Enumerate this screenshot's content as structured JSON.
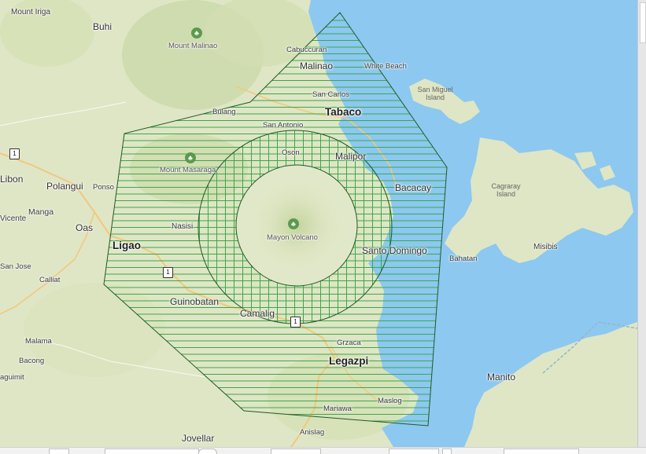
{
  "map": {
    "labels": {
      "mount_iriga": "Mount Iriga",
      "buhi": "Buhi",
      "mount_malinao": "Mount Malinao",
      "cabuccuran": "Cabuccuran",
      "malinao": "Malinao",
      "white_beach": "White Beach",
      "san_carlos": "San Carlos",
      "san_miguel_island": "San Miguel Island",
      "bulang": "Bulang",
      "tabaco": "Tabaco",
      "san_antonio": "San Antonio",
      "oson": "Oson",
      "malipor": "Malipor",
      "mount_masaraga": "Mount Masaraga",
      "libon": "Libon",
      "polangui": "Polangui",
      "ponso": "Ponso",
      "bacacay": "Bacacay",
      "cagraray_island": "Cagraray Island",
      "manga": "Manga",
      "vicente": "Vicente",
      "oas": "Oas",
      "nasisi": "Nasisi",
      "mayon_volcano": "Mayon Volcano",
      "ligao": "Ligao",
      "santo_domingo": "Santo Domingo",
      "bahatan": "Bahatan",
      "misibis": "Misibis",
      "san_jose": "San Jose",
      "calliat": "Calliat",
      "guinobatan": "Guinobatan",
      "camalig": "Camalig",
      "malama": "Malama",
      "grzaca": "Grzaca",
      "bacong": "Bacong",
      "legazpi": "Legazpi",
      "manito": "Manito",
      "aguimit": "aguimit",
      "maslog": "Maslog",
      "mariawa": "Mariawa",
      "jovellar": "Jovellar",
      "anislag": "Anislag"
    },
    "highway_shield": "1",
    "colors": {
      "land": "#dfe6c5",
      "land_hill": "#cfdcae",
      "water": "#8cc8f0",
      "zone_stroke": "#1e5a28",
      "hatch": "#3aa84a",
      "road": "#f3c77a"
    },
    "icons": [
      "park-icon",
      "volcano-icon",
      "highway-shield-icon"
    ]
  }
}
